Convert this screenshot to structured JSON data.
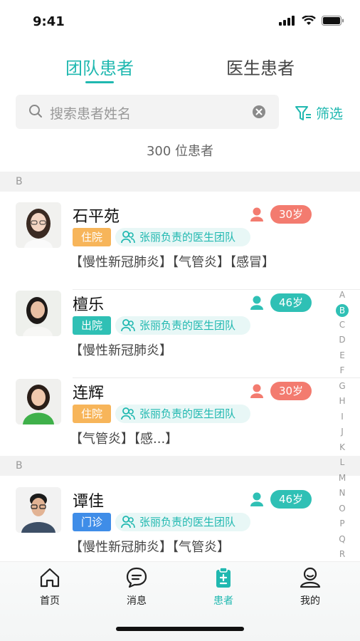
{
  "status_bar": {
    "time": "9:41"
  },
  "tabs": [
    {
      "label": "团队患者",
      "active": true
    },
    {
      "label": "医生患者",
      "active": false
    }
  ],
  "search": {
    "placeholder": "搜索患者姓名"
  },
  "filter": {
    "label": "筛选"
  },
  "patient_count": "300 位患者",
  "sections": [
    {
      "letter": "B",
      "patients": [
        {
          "name": "石平苑",
          "gender": "female",
          "age": "30岁",
          "status": "住院",
          "team": "张丽负责的医生团队",
          "diagnoses": "【慢性新冠肺炎】【气管炎】【感冒】"
        },
        {
          "name": "檀乐",
          "gender": "male",
          "age": "46岁",
          "status": "出院",
          "team": "张丽负责的医生团队",
          "diagnoses": "【慢性新冠肺炎】"
        },
        {
          "name": "连辉",
          "gender": "female",
          "age": "30岁",
          "status": "住院",
          "team": "张丽负责的医生团队",
          "diagnoses": "【气管炎】【感...】"
        }
      ]
    },
    {
      "letter": "B",
      "patients": [
        {
          "name": "谭佳",
          "gender": "male",
          "age": "46岁",
          "status": "门诊",
          "team": "张丽负责的医生团队",
          "diagnoses": "【慢性新冠肺炎】【气管炎】"
        }
      ]
    }
  ],
  "alpha_index": [
    "A",
    "B",
    "C",
    "D",
    "E",
    "F",
    "G",
    "H",
    "I",
    "J",
    "K",
    "L",
    "M",
    "N",
    "O",
    "P",
    "Q",
    "R"
  ],
  "alpha_active": "B",
  "bottom_nav": [
    {
      "label": "首页",
      "icon": "home-icon"
    },
    {
      "label": "消息",
      "icon": "message-icon"
    },
    {
      "label": "患者",
      "icon": "patient-icon",
      "active": true
    },
    {
      "label": "我的",
      "icon": "profile-icon"
    }
  ],
  "colors": {
    "accent": "#20b8b0",
    "female": "#f37b6f",
    "male": "#2fc0b5",
    "inpatient": "#f7b55a",
    "discharged": "#2fc0b5",
    "outpatient": "#3f8de8"
  }
}
